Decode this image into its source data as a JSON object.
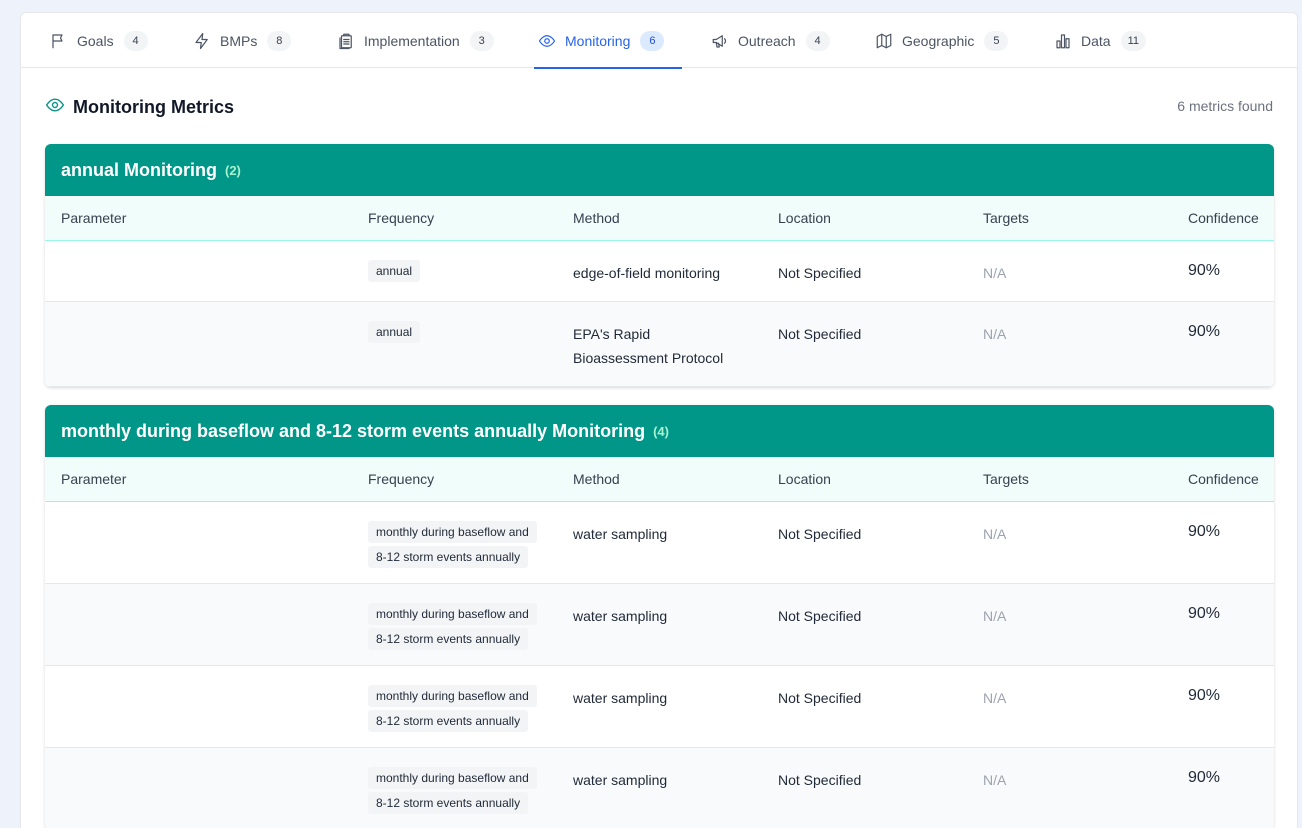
{
  "tabs": [
    {
      "label": "Goals",
      "count": "4",
      "icon": "flag-icon"
    },
    {
      "label": "BMPs",
      "count": "8",
      "icon": "lightning-icon"
    },
    {
      "label": "Implementation",
      "count": "3",
      "icon": "clipboard-icon"
    },
    {
      "label": "Monitoring",
      "count": "6",
      "icon": "eye-icon",
      "active": true
    },
    {
      "label": "Outreach",
      "count": "4",
      "icon": "megaphone-icon"
    },
    {
      "label": "Geographic",
      "count": "5",
      "icon": "map-icon"
    },
    {
      "label": "Data",
      "count": "11",
      "icon": "bar-chart-icon"
    }
  ],
  "section": {
    "title": "Monitoring Metrics",
    "count_text": "6 metrics found",
    "icon": "eye-icon"
  },
  "columns": [
    "Parameter",
    "Frequency",
    "Method",
    "Location",
    "Targets",
    "Confidence"
  ],
  "groups": [
    {
      "title": "annual Monitoring",
      "count": "(2)",
      "rows": [
        {
          "parameter": "",
          "frequency": "annual",
          "method": "edge-of-field monitoring",
          "location": "Not Specified",
          "targets": "N/A",
          "confidence": "90%"
        },
        {
          "parameter": "",
          "frequency": "annual",
          "method": "EPA's Rapid Bioassessment Protocol",
          "location": "Not Specified",
          "targets": "N/A",
          "confidence": "90%"
        }
      ]
    },
    {
      "title": "monthly during baseflow and 8-12 storm events annually Monitoring",
      "count": "(4)",
      "rows": [
        {
          "parameter": "",
          "frequency": "monthly during baseflow and 8-12 storm events annually",
          "method": "water sampling",
          "location": "Not Specified",
          "targets": "N/A",
          "confidence": "90%"
        },
        {
          "parameter": "",
          "frequency": "monthly during baseflow and 8-12 storm events annually",
          "method": "water sampling",
          "location": "Not Specified",
          "targets": "N/A",
          "confidence": "90%"
        },
        {
          "parameter": "",
          "frequency": "monthly during baseflow and 8-12 storm events annually",
          "method": "water sampling",
          "location": "Not Specified",
          "targets": "N/A",
          "confidence": "90%"
        },
        {
          "parameter": "",
          "frequency": "monthly during baseflow and 8-12 storm events annually",
          "method": "water sampling",
          "location": "Not Specified",
          "targets": "N/A",
          "confidence": "90%"
        }
      ]
    }
  ],
  "colors": {
    "accent": "#2563eb",
    "group_header": "#009688",
    "teal_icon": "#0d9488"
  }
}
